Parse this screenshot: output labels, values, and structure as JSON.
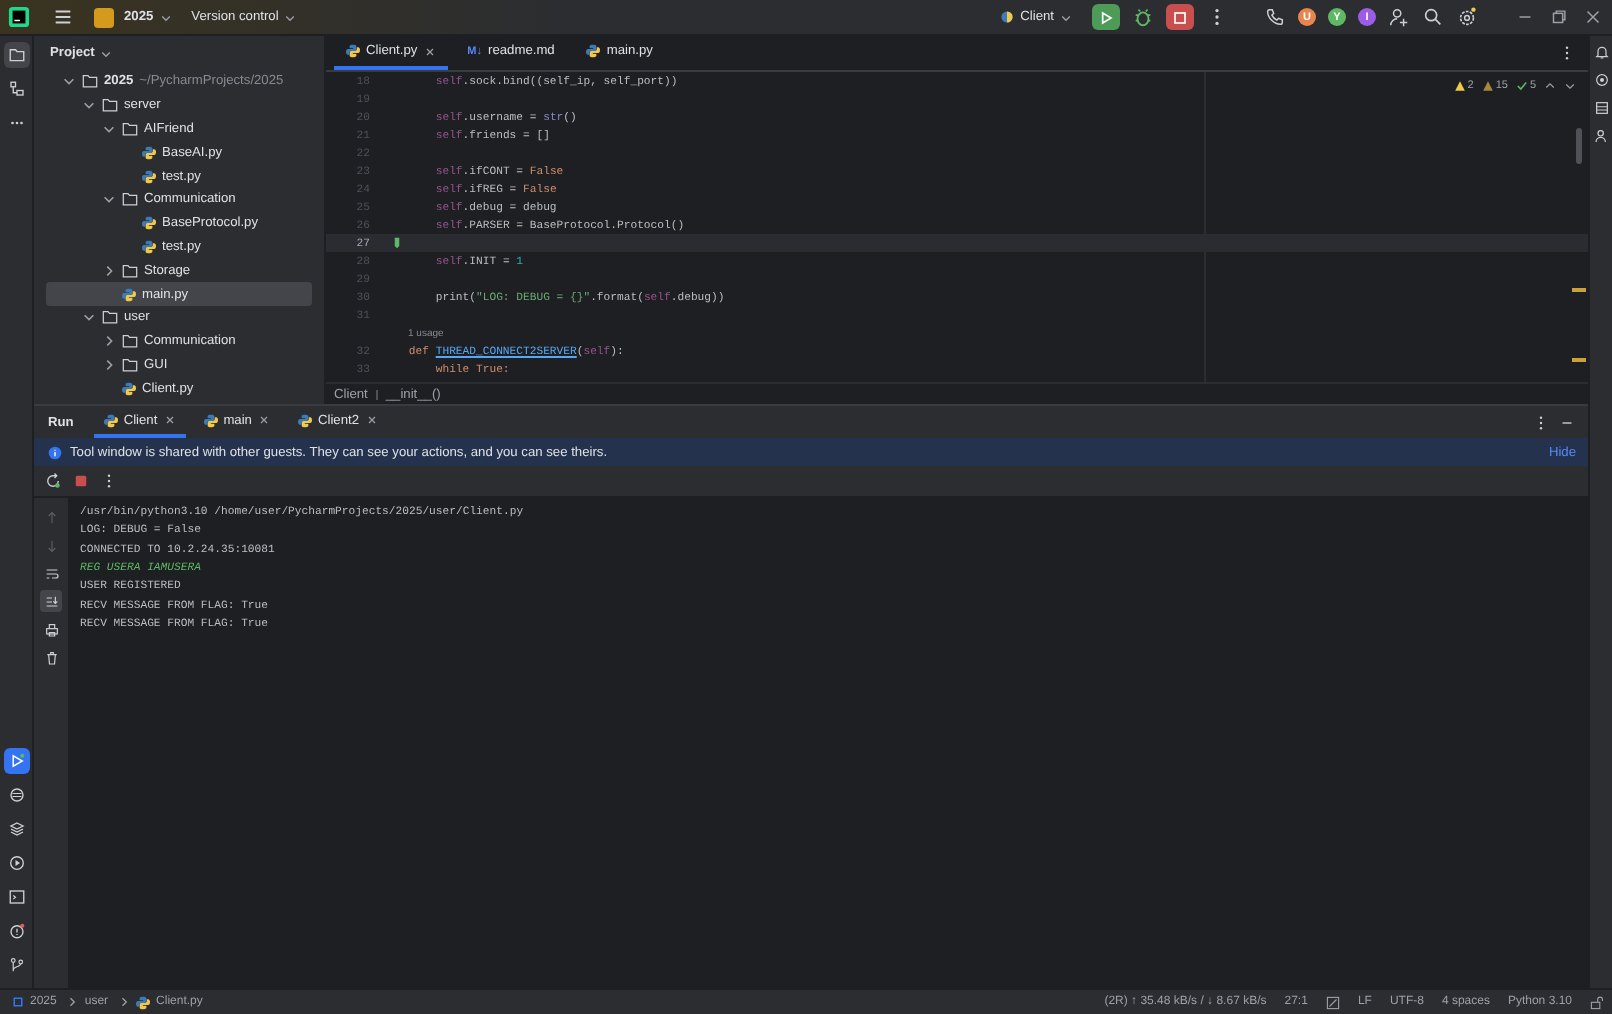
{
  "toolbar": {
    "project": "2025",
    "vcs": "Version control",
    "run_config": "Client",
    "avatars": [
      {
        "letter": "U",
        "color": "#e8854f"
      },
      {
        "letter": "Y",
        "color": "#5fb865"
      },
      {
        "letter": "I",
        "color": "#9b5de5"
      }
    ]
  },
  "left_strip": {
    "top": [
      {
        "kind": "folder",
        "selected": true
      },
      {
        "kind": "structure",
        "selected": false
      },
      {
        "kind": "more",
        "selected": false
      }
    ],
    "bottom": [
      {
        "kind": "run",
        "selected": true
      },
      {
        "kind": "packages",
        "selected": false
      },
      {
        "kind": "layers",
        "selected": false
      },
      {
        "kind": "services",
        "selected": false
      },
      {
        "kind": "terminal",
        "selected": false
      },
      {
        "kind": "problems",
        "selected": false
      },
      {
        "kind": "git",
        "selected": false
      }
    ]
  },
  "project": {
    "title": "Project",
    "tree": [
      {
        "kind": "folder",
        "name": "2025",
        "path": "~/PycharmProjects/2025",
        "expanded": true,
        "selected": false,
        "children": [
          {
            "kind": "folder",
            "name": "server",
            "expanded": true,
            "selected": false,
            "children": [
              {
                "kind": "folder",
                "name": "AIFriend",
                "expanded": true,
                "selected": false,
                "children": [
                  {
                    "kind": "python",
                    "name": "BaseAI.py",
                    "selected": false
                  },
                  {
                    "kind": "python",
                    "name": "test.py",
                    "selected": false
                  }
                ]
              },
              {
                "kind": "folder",
                "name": "Communication",
                "expanded": true,
                "selected": false,
                "children": [
                  {
                    "kind": "python",
                    "name": "BaseProtocol.py",
                    "selected": false
                  },
                  {
                    "kind": "python",
                    "name": "test.py",
                    "selected": false
                  }
                ]
              },
              {
                "kind": "folder",
                "name": "Storage",
                "expanded": false,
                "selected": false
              },
              {
                "kind": "python",
                "name": "main.py",
                "selected": true
              }
            ]
          },
          {
            "kind": "folder",
            "name": "user",
            "expanded": true,
            "selected": false,
            "children": [
              {
                "kind": "folder",
                "name": "Communication",
                "expanded": false,
                "selected": false
              },
              {
                "kind": "folder",
                "name": "GUI",
                "expanded": false,
                "selected": false
              },
              {
                "kind": "python",
                "name": "Client.py",
                "selected": false
              }
            ]
          }
        ]
      }
    ]
  },
  "editor": {
    "tabs": [
      {
        "kind": "python",
        "label": "Client.py",
        "selected": true,
        "closable": true
      },
      {
        "kind": "markdown",
        "badge": "M↓",
        "label": "readme.md",
        "selected": false,
        "closable": false
      },
      {
        "kind": "python",
        "label": "main.py",
        "selected": false,
        "closable": false
      }
    ],
    "inspections": [
      {
        "kind": "warning",
        "count": "2"
      },
      {
        "kind": "weak",
        "count": "15"
      },
      {
        "kind": "ok",
        "count": "5"
      }
    ],
    "lines": [
      {
        "number": "18",
        "segments": [
          {
            "text": "        self",
            "kind": "self"
          },
          {
            "text": ".sock.bind((self_ip, self_port))",
            "kind": "plain"
          }
        ]
      },
      {
        "number": "19"
      },
      {
        "number": "20",
        "segments": [
          {
            "text": "        self",
            "kind": "self"
          },
          {
            "text": ".username = ",
            "kind": "plain"
          },
          {
            "text": "str",
            "kind": "builtin"
          },
          {
            "text": "()",
            "kind": "plain"
          }
        ]
      },
      {
        "number": "21",
        "segments": [
          {
            "text": "        self",
            "kind": "self"
          },
          {
            "text": ".friends = []",
            "kind": "plain"
          }
        ]
      },
      {
        "number": "22"
      },
      {
        "number": "23",
        "segments": [
          {
            "text": "        self",
            "kind": "self"
          },
          {
            "text": ".ifCONT = ",
            "kind": "plain"
          },
          {
            "text": "False",
            "kind": "keyword"
          }
        ]
      },
      {
        "number": "24",
        "segments": [
          {
            "text": "        self",
            "kind": "self"
          },
          {
            "text": ".ifREG = ",
            "kind": "plain"
          },
          {
            "text": "False",
            "kind": "keyword"
          }
        ]
      },
      {
        "number": "25",
        "segments": [
          {
            "text": "        self",
            "kind": "self"
          },
          {
            "text": ".debug = debug",
            "kind": "plain"
          }
        ]
      },
      {
        "number": "26",
        "segments": [
          {
            "text": "        self",
            "kind": "self"
          },
          {
            "text": ".PARSER = BaseProtocol.Protocol()",
            "kind": "plain"
          }
        ]
      },
      {
        "number": "27",
        "current": true
      },
      {
        "number": "28",
        "segments": [
          {
            "text": "        self",
            "kind": "self"
          },
          {
            "text": ".INIT = ",
            "kind": "plain"
          },
          {
            "text": "1",
            "kind": "number"
          }
        ]
      },
      {
        "number": "29"
      },
      {
        "number": "30",
        "segments": [
          {
            "text": "        print(",
            "kind": "plain"
          },
          {
            "text": "\"LOG: DEBUG = {}\"",
            "kind": "string"
          },
          {
            "text": ".format(",
            "kind": "plain"
          },
          {
            "text": "self",
            "kind": "self"
          },
          {
            "text": ".debug))",
            "kind": "plain"
          }
        ]
      },
      {
        "number": "31",
        "hint": "1 usage"
      },
      {
        "number": "32",
        "segments": [
          {
            "text": "    def ",
            "kind": "keyword"
          },
          {
            "text": "THREAD_CONNECT2SERVER",
            "kind": "function"
          },
          {
            "text": "(",
            "kind": "plain"
          },
          {
            "text": "self",
            "kind": "self"
          },
          {
            "text": "):",
            "kind": "plain"
          }
        ]
      },
      {
        "number": "33",
        "segments": [
          {
            "text": "        while True:",
            "kind": "keyword"
          }
        ]
      }
    ],
    "breadcrumb": [
      "Client",
      "__init__()"
    ]
  },
  "run": {
    "title": "Run",
    "tabs": [
      {
        "label": "Client",
        "selected": true
      },
      {
        "label": "main",
        "selected": false
      },
      {
        "label": "Client2",
        "selected": false
      }
    ],
    "banner": {
      "text": "Tool window is shared with other guests. They can see your actions, and you can see theirs.",
      "action": "Hide"
    },
    "side_tools": [
      {
        "kind": "up",
        "selected": false
      },
      {
        "kind": "down",
        "selected": false
      },
      {
        "kind": "wrap",
        "selected": false
      },
      {
        "kind": "scroll-end",
        "selected": true
      },
      {
        "kind": "print",
        "selected": false
      },
      {
        "kind": "trash",
        "selected": false
      }
    ],
    "console": [
      {
        "kind": "plain",
        "text": "/usr/bin/python3.10 /home/user/PycharmProjects/2025/user/Client.py"
      },
      {
        "kind": "plain",
        "text": "LOG: DEBUG = False"
      },
      {
        "kind": "plain",
        "text": "CONNECTED TO 10.2.24.35:10081"
      },
      {
        "kind": "input",
        "text": "REG USERA IAMUSERA"
      },
      {
        "kind": "plain",
        "text": "USER REGISTERED"
      },
      {
        "kind": "plain",
        "text": "RECV MESSAGE FROM FLAG: True"
      },
      {
        "kind": "plain",
        "text": "RECV MESSAGE FROM FLAG: True"
      }
    ]
  },
  "status_bar": {
    "path": [
      "2025",
      "user",
      "Client.py"
    ],
    "items": [
      {
        "kind": "text",
        "text": "(2R) ↑ 35.48 kB/s / ↓ 8.67 kB/s"
      },
      {
        "kind": "text",
        "text": "27:1"
      },
      {
        "kind": "icon"
      },
      {
        "kind": "text",
        "text": "LF"
      },
      {
        "kind": "text",
        "text": "UTF-8"
      },
      {
        "kind": "text",
        "text": "4 spaces"
      },
      {
        "kind": "text",
        "text": "Python 3.10"
      },
      {
        "kind": "lock"
      }
    ]
  }
}
